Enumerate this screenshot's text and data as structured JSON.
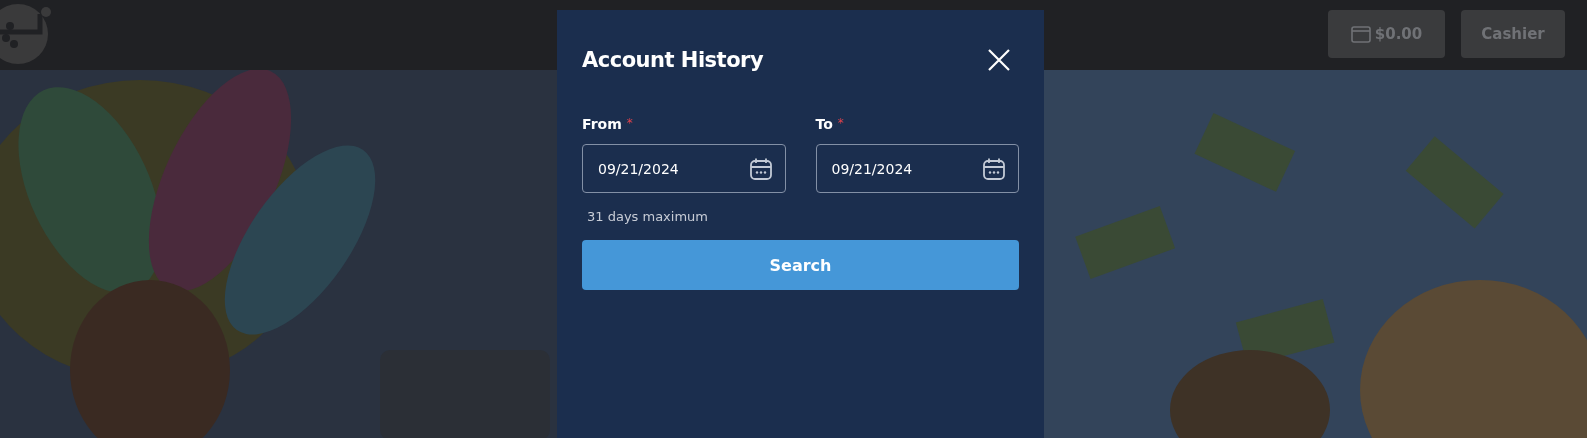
{
  "header": {
    "balance_button": {
      "label": "$0.00"
    },
    "cashier_button": {
      "label": "Cashier"
    }
  },
  "modal": {
    "title": "Account History",
    "fields": [
      {
        "label": "From",
        "required_mark": "*",
        "value": "09/21/2024"
      },
      {
        "label": "To",
        "required_mark": "*",
        "value": "09/21/2024"
      }
    ],
    "hint": "31 days maximum",
    "search_button": {
      "label": "Search"
    }
  }
}
